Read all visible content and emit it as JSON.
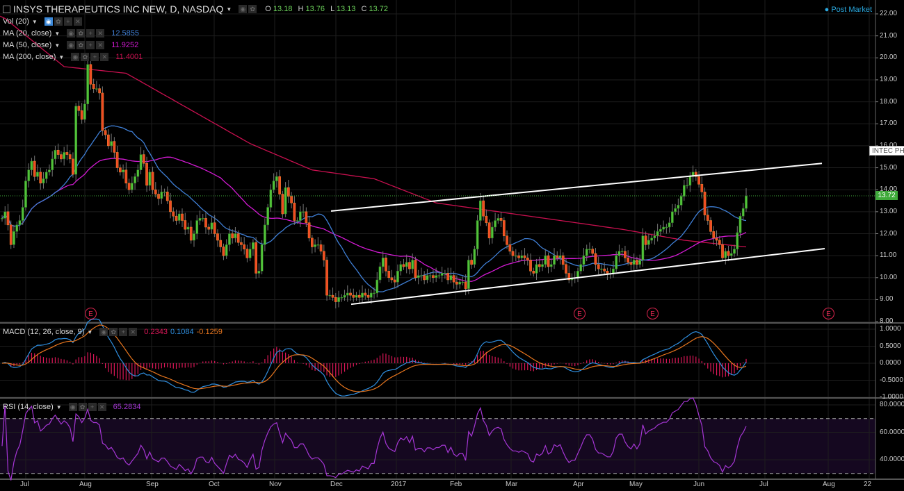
{
  "header": {
    "symbol_title": "INSYS THERAPEUTICS INC NEW, D, NASDAQ",
    "ohlc": {
      "o_label": "O",
      "o": "13.18",
      "h_label": "H",
      "h": "13.76",
      "l_label": "L",
      "l": "13.13",
      "c_label": "C",
      "c": "13.72"
    },
    "post_market": "Post Market"
  },
  "indicators": {
    "vol": {
      "label": "Vol (20)"
    },
    "ma20": {
      "label": "MA (20, close)",
      "value": "12.5855",
      "color": "#3f7fd6"
    },
    "ma50": {
      "label": "MA (50, close)",
      "value": "11.9252",
      "color": "#d41ad4"
    },
    "ma200": {
      "label": "MA (200, close)",
      "value": "11.4001",
      "color": "#c8104f"
    },
    "macd": {
      "label": "MACD (12, 26, close, 9)",
      "hist": "0.2343",
      "macd": "0.1084",
      "signal": "-0.1259"
    },
    "rsi": {
      "label": "RSI (14, close)",
      "value": "65.2834"
    }
  },
  "price_axis": [
    "22.00",
    "21.00",
    "20.00",
    "19.00",
    "18.00",
    "17.00",
    "16.00",
    "15.00",
    "14.00",
    "13.00",
    "12.00",
    "11.00",
    "10.00",
    "9.00",
    "8.00"
  ],
  "macd_axis": [
    "1.0000",
    "0.5000",
    "0.0000",
    "-0.5000",
    "-1.0000"
  ],
  "rsi_axis": [
    "80.0000",
    "60.0000",
    "40.0000"
  ],
  "time_axis": [
    "Jul",
    "Aug",
    "Sep",
    "Oct",
    "Nov",
    "Dec",
    "2017",
    "Feb",
    "Mar",
    "Apr",
    "May",
    "Jun",
    "Jul",
    "Aug",
    "22"
  ],
  "last_price": "13.72",
  "note_tag": "INTEC PH",
  "earnings_marker": "E",
  "colors": {
    "up": "#52c33a",
    "down": "#f04a23",
    "macd": "#2f8fe0",
    "signal": "#e8761e",
    "hist": "#e0185a",
    "rsi": "#a636d6",
    "trend": "#ffffff"
  },
  "chart_data": {
    "type": "candlestick",
    "title": "INSYS THERAPEUTICS INC NEW, D, NASDAQ",
    "ylim": [
      8,
      22
    ],
    "closes": [
      12.7,
      13.0,
      12.4,
      11.5,
      12.1,
      12.4,
      12.6,
      13.2,
      14.4,
      14.9,
      15.3,
      14.6,
      14.8,
      14.3,
      14.5,
      14.8,
      14.9,
      15.4,
      15.8,
      15.6,
      15.4,
      15.7,
      15.6,
      15.4,
      14.7,
      17.8,
      17.6,
      17.2,
      17.9,
      19.7,
      18.8,
      18.6,
      18.6,
      18.4,
      16.7,
      16.5,
      16.0,
      16.2,
      15.7,
      15.0,
      14.8,
      14.9,
      14.3,
      14.0,
      14.3,
      14.6,
      14.9,
      15.6,
      15.2,
      14.2,
      14.8,
      14.0,
      13.8,
      13.6,
      13.9,
      13.9,
      13.5,
      13.0,
      12.8,
      12.6,
      12.9,
      12.6,
      12.2,
      12.3,
      11.7,
      12.0,
      12.6,
      12.7,
      12.7,
      12.3,
      12.2,
      12.5,
      12.0,
      11.7,
      11.4,
      11.0,
      11.5,
      12.0,
      11.8,
      12.0,
      11.6,
      11.5,
      11.3,
      10.9,
      11.3,
      11.6,
      10.2,
      10.3,
      11.5,
      12.4,
      13.2,
      14.0,
      14.4,
      14.6,
      13.8,
      12.9,
      14.1,
      13.7,
      13.4,
      12.6,
      12.6,
      13.0,
      13.0,
      12.5,
      11.8,
      11.4,
      11.5,
      11.5,
      11.2,
      10.8,
      9.2,
      9.2,
      9.1,
      8.9,
      9.1,
      9.1,
      9.2,
      9.3,
      9.2,
      9.1,
      9.2,
      9.1,
      9.3,
      9.2,
      9.1,
      9.3,
      9.3,
      9.9,
      10.5,
      10.9,
      10.3,
      10.0,
      9.9,
      9.8,
      10.3,
      10.6,
      10.5,
      10.7,
      10.4,
      10.8,
      10.0,
      10.1,
      10.1,
      9.9,
      10.1,
      10.1,
      10.0,
      10.1,
      10.1,
      10.2,
      10.2,
      9.9,
      10.1,
      9.8,
      9.7,
      9.8,
      9.8,
      9.5,
      10.8,
      10.6,
      11.3,
      12.6,
      13.5,
      12.8,
      12.5,
      11.8,
      12.3,
      12.6,
      12.7,
      12.6,
      11.9,
      11.5,
      11.2,
      11.0,
      11.0,
      10.9,
      11.0,
      10.9,
      10.8,
      10.3,
      10.2,
      10.6,
      10.5,
      10.6,
      11.0,
      10.5,
      10.6,
      11.0,
      10.9,
      11.0,
      10.6,
      10.2,
      9.9,
      10.0,
      10.0,
      10.3,
      10.6,
      11.0,
      11.3,
      11.3,
      11.1,
      10.6,
      10.4,
      10.4,
      10.3,
      10.2,
      10.2,
      10.4,
      11.0,
      11.2,
      11.2,
      10.9,
      10.7,
      10.6,
      10.8,
      10.6,
      10.8,
      11.9,
      11.5,
      11.7,
      11.8,
      11.9,
      12.1,
      12.2,
      12.3,
      12.3,
      12.5,
      13.0,
      13.15,
      13.3,
      13.7,
      14.2,
      14.2,
      14.6,
      14.8,
      14.6,
      14.25,
      13.9,
      12.85,
      12.6,
      12.1,
      11.8,
      11.7,
      11.5,
      10.9,
      11.2,
      11.0,
      11.1,
      11.3,
      12.05,
      12.8,
      13.15,
      13.72
    ],
    "ma200_keypoints": [
      21.9,
      19.6,
      19.3,
      17.7,
      16.1,
      14.9,
      14.5,
      13.4,
      13.0,
      12.6,
      12.2,
      11.7,
      11.4
    ],
    "rsi_bands": [
      70,
      30
    ],
    "macd_range": [
      -1,
      1.1
    ],
    "rsi_range": [
      25,
      85
    ]
  }
}
